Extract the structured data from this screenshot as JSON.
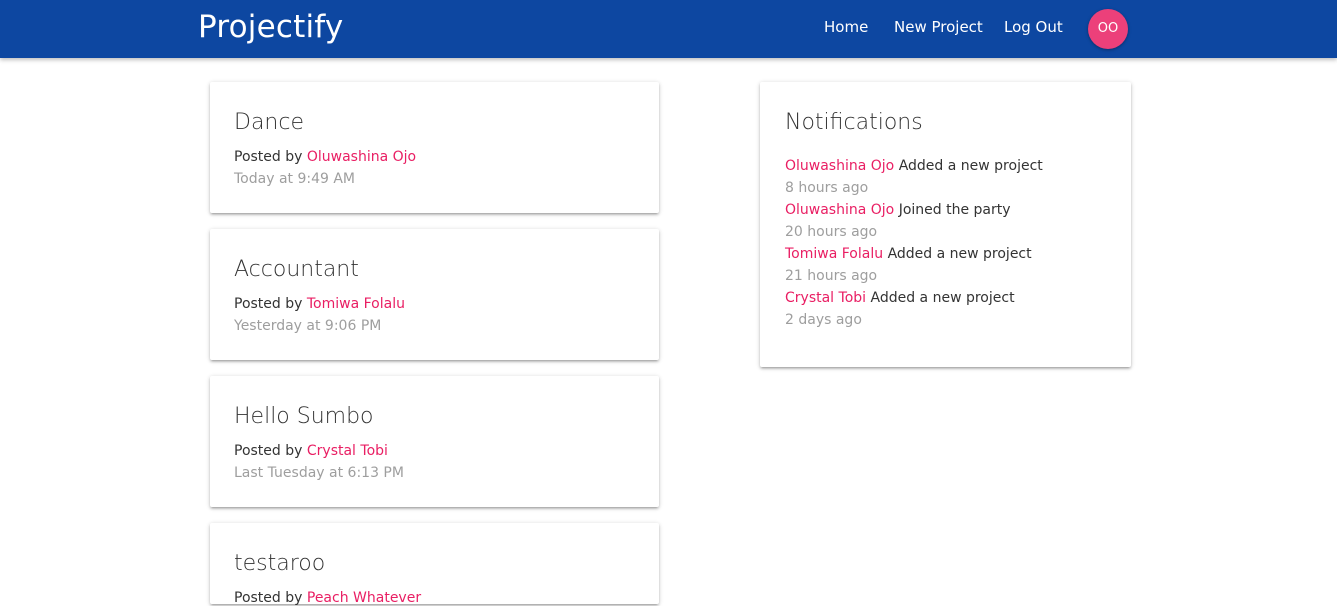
{
  "navbar": {
    "brand": "Projectify",
    "links": [
      "Home",
      "New Project",
      "Log Out"
    ],
    "avatar_initials": "OO"
  },
  "projects": [
    {
      "title": "Dance",
      "posted_prefix": "Posted by",
      "author": "Oluwashina Ojo",
      "date": "Today at 9:49 AM"
    },
    {
      "title": "Accountant",
      "posted_prefix": "Posted by",
      "author": "Tomiwa Folalu",
      "date": "Yesterday at 9:06 PM"
    },
    {
      "title": "Hello Sumbo",
      "posted_prefix": "Posted by",
      "author": "Crystal Tobi",
      "date": "Last Tuesday at 6:13 PM"
    },
    {
      "title": "testaroo",
      "posted_prefix": "Posted by",
      "author": "Peach Whatever",
      "date": ""
    }
  ],
  "notifications": {
    "title": "Notifications",
    "items": [
      {
        "user": "Oluwashina Ojo",
        "content": "Added a new project",
        "time": "8 hours ago"
      },
      {
        "user": "Oluwashina Ojo",
        "content": "Joined the party",
        "time": "20 hours ago"
      },
      {
        "user": "Tomiwa Folalu",
        "content": "Added a new project",
        "time": "21 hours ago"
      },
      {
        "user": "Crystal Tobi",
        "content": "Added a new project",
        "time": "2 days ago"
      }
    ]
  },
  "colors": {
    "navbar": "#0d47a1",
    "accent": "#e91e63",
    "avatar": "#ec407a",
    "muted": "#9e9e9e"
  }
}
